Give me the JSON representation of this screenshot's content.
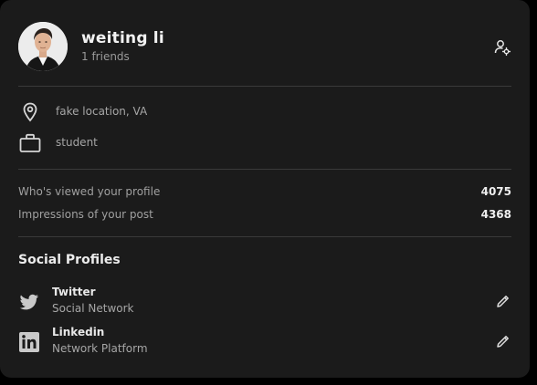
{
  "profile": {
    "name": "weiting li",
    "friends": "1 friends"
  },
  "info": {
    "location": "fake location, VA",
    "occupation": "student"
  },
  "stats": [
    {
      "label": "Who's viewed your profile",
      "value": "4075"
    },
    {
      "label": "Impressions of your post",
      "value": "4368"
    }
  ],
  "social": {
    "title": "Social Profiles",
    "items": [
      {
        "name": "Twitter",
        "type": "Social Network",
        "icon": "twitter-icon"
      },
      {
        "name": "Linkedin",
        "type": "Network Platform",
        "icon": "linkedin-icon"
      }
    ]
  },
  "colors": {
    "card_background": "#1b1b1b",
    "page_background": "#000000",
    "divider": "#3a3a3a",
    "primary_text": "#f2f2f2",
    "secondary_text": "#a6a6a6",
    "icon": "#c8c8c8"
  }
}
